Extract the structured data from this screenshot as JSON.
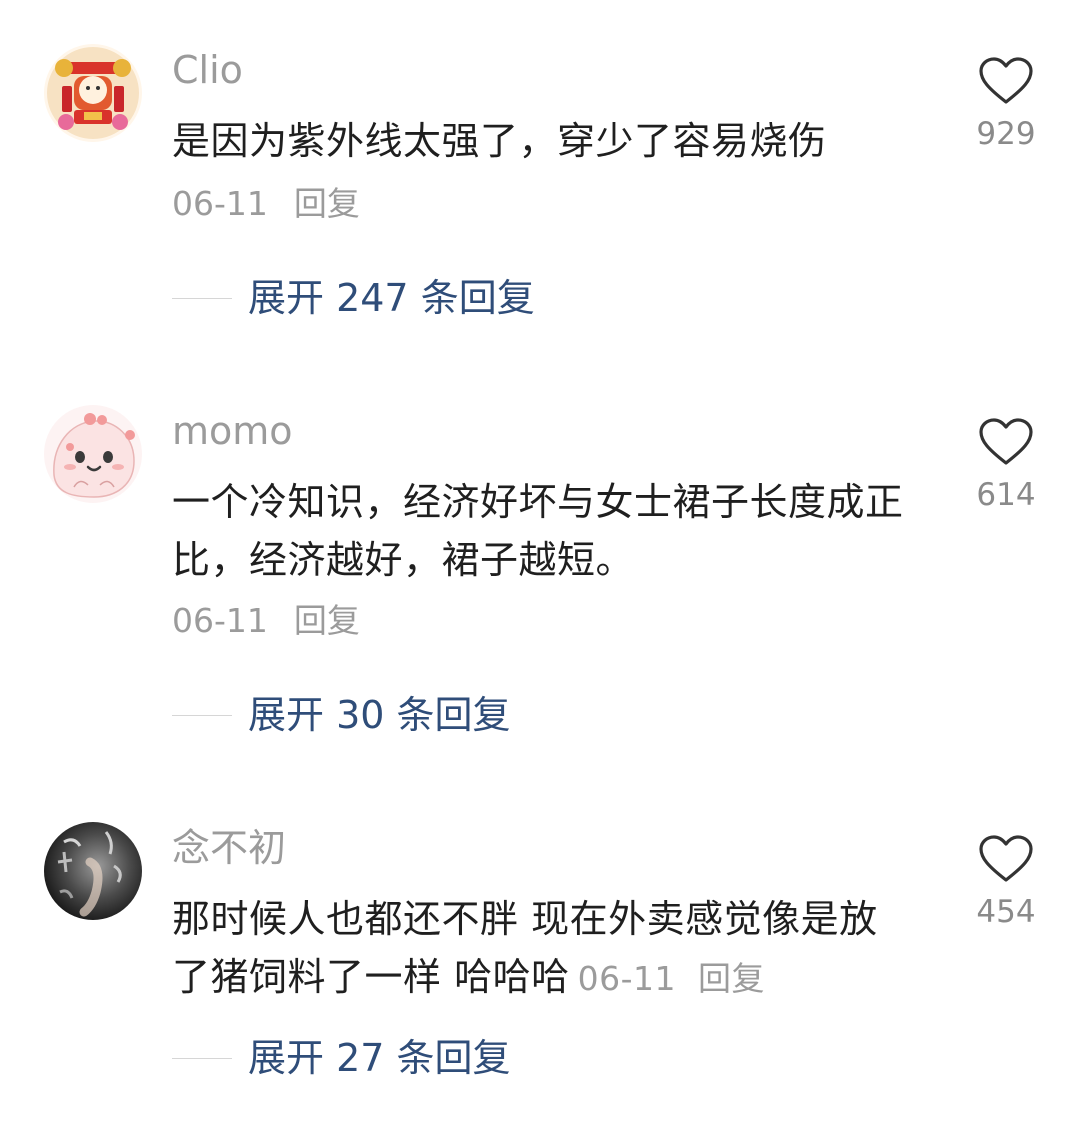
{
  "comments": [
    {
      "username": "Clio",
      "avatar_icon": "new-year-mascot-avatar",
      "text": "是因为紫外线太强了，穿少了容易烧伤",
      "date": "06-11",
      "reply_label": "回复",
      "like_icon": "heart-outline-icon",
      "like_count": "929",
      "expand_label": "展开 247 条回复"
    },
    {
      "username": "momo",
      "avatar_icon": "pink-blob-avatar",
      "text": "一个冷知识，经济好坏与女士裙子长度成正比，经济越好，裙子越短。",
      "date": "06-11",
      "reply_label": "回复",
      "like_icon": "heart-outline-icon",
      "like_count": "614",
      "expand_label": "展开 30 条回复"
    },
    {
      "username": "念不初",
      "avatar_icon": "dark-calligraphy-avatar",
      "text": "那时候人也都还不胖 现在外卖感觉像是放了猪饲料了一样 哈哈哈",
      "date": "06-11",
      "reply_label": "回复",
      "like_icon": "heart-outline-icon",
      "like_count": "454",
      "expand_label": "展开 27 条回复"
    }
  ],
  "colors": {
    "username": "#9b9b9b",
    "body_text": "#1f1f1f",
    "meta": "#9b9b9b",
    "expand_link": "#2f4d79",
    "divider": "#d6d6d6",
    "heart_stroke": "#333333"
  }
}
